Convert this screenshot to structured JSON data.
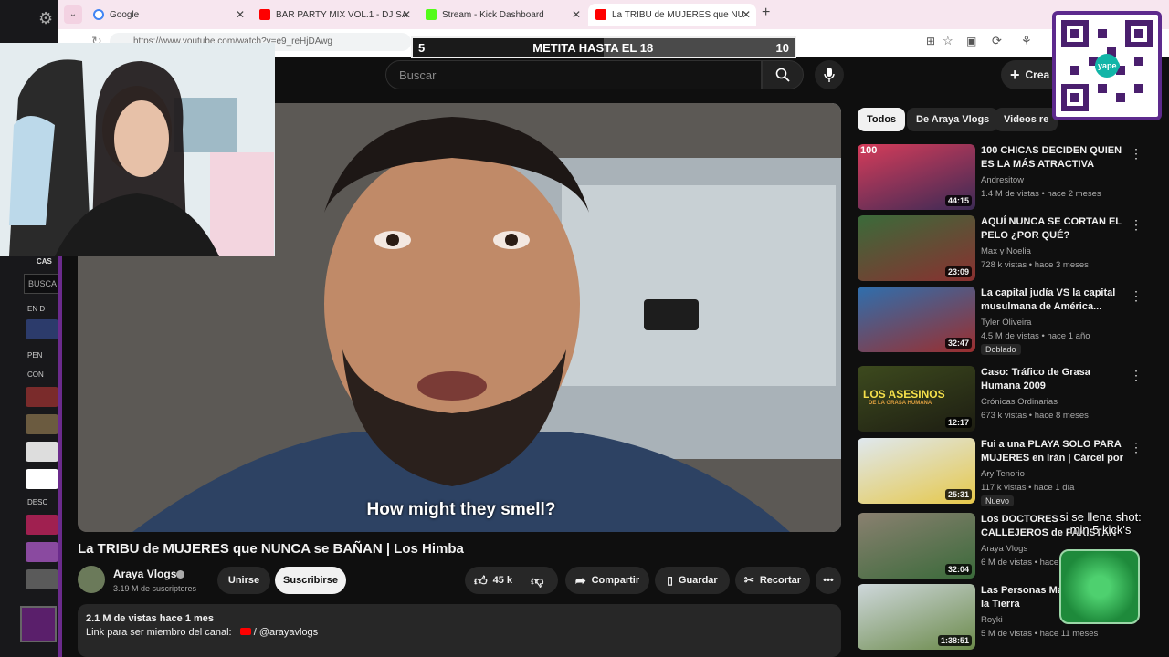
{
  "browser": {
    "tabs": [
      {
        "label": "Google",
        "color": "#4285f4"
      },
      {
        "label": "BAR PARTY MIX VOL.1 - DJ SA",
        "color": "#ff0000"
      },
      {
        "label": "Stream - Kick Dashboard",
        "color": "#53fc18"
      },
      {
        "label": "La TRIBU de MUJERES que NU",
        "color": "#ff0000"
      }
    ],
    "new_tab": "+",
    "url": "https://www.youtube.com/watch?v=e9_reHjDAwg"
  },
  "goal_overlay": {
    "start": "5",
    "label": "METITA HASTA EL 18",
    "end": "10",
    "progress_fraction": 0.5
  },
  "youtube": {
    "search_placeholder": "Buscar",
    "create_label": "Crea",
    "subtitle": "How might they smell?",
    "video_title": "La TRIBU de MUJERES que NUNCA se BAÑAN | Los Himba",
    "channel": {
      "name": "Araya Vlogs",
      "subs": "3.19 M de suscriptores"
    },
    "join_label": "Unirse",
    "subscribe_label": "Suscribirse",
    "likes": "45 k",
    "share_label": "Compartir",
    "save_label": "Guardar",
    "clip_label": "Recortar",
    "description": {
      "stats": "2.1 M de vistas  hace 1 mes",
      "line": "Link para ser miembro del canal:",
      "link": "/ @arayavlogs"
    },
    "chips": [
      "Todos",
      "De Araya Vlogs",
      "Videos re"
    ],
    "recommendations": [
      {
        "title": "100 CHICAS DECIDEN QUIEN ES LA MÁS ATRACTIVA",
        "channel": "Andresitow",
        "meta": "1.4 M de vistas • hace 2 meses",
        "duration": "44:15",
        "badge": ""
      },
      {
        "title": "AQUÍ NUNCA SE CORTAN EL PELO ¿POR QUÉ?",
        "channel": "Max y Noelia",
        "meta": "728 k vistas • hace 3 meses",
        "duration": "23:09",
        "badge": ""
      },
      {
        "title": "La capital judía VS la capital musulmana de América...",
        "channel": "Tyler Oliveira",
        "meta": "4.5 M de vistas • hace 1 año",
        "duration": "32:47",
        "badge": "Doblado"
      },
      {
        "title": "Caso: Tráfico de Grasa Humana 2009",
        "channel": "Crónicas Ordinarias",
        "meta": "673 k vistas • hace 8 meses",
        "duration": "12:17",
        "badge": ""
      },
      {
        "title": "Fui a una PLAYA SOLO PARA MUJERES en Irán | Cárcel por ...",
        "channel": "Ary Tenorio",
        "meta": "117 k vistas • hace 1 día",
        "duration": "25:31",
        "badge": "Nuevo"
      },
      {
        "title": "Los DOCTORES CALLEJEROS de PAKISTÁN",
        "channel": "Araya Vlogs",
        "meta": "6 M de vistas • hace 2 meses",
        "duration": "32:04",
        "badge": ""
      },
      {
        "title": "Las Personas Más Únicas de la Tierra",
        "channel": "Royki",
        "meta": "5 M de vistas • hace 11 meses",
        "duration": "1:38:51",
        "badge": ""
      }
    ],
    "thumb_texts": {
      "t1": "100",
      "t4": "LOS ASESINOS",
      "t4sub": "DE LA GRASA HUMANA"
    }
  },
  "stream_overlay": {
    "shot_note_1": "si se llena shot:",
    "shot_note_2": "min 5 kick's",
    "qr_brand": "yape"
  },
  "kick_sidebar": {
    "section_cas": "CAS",
    "search": "BUSCA",
    "en_d": "EN D",
    "pen": "PEN",
    "con": "CON",
    "desc": "DESC"
  }
}
